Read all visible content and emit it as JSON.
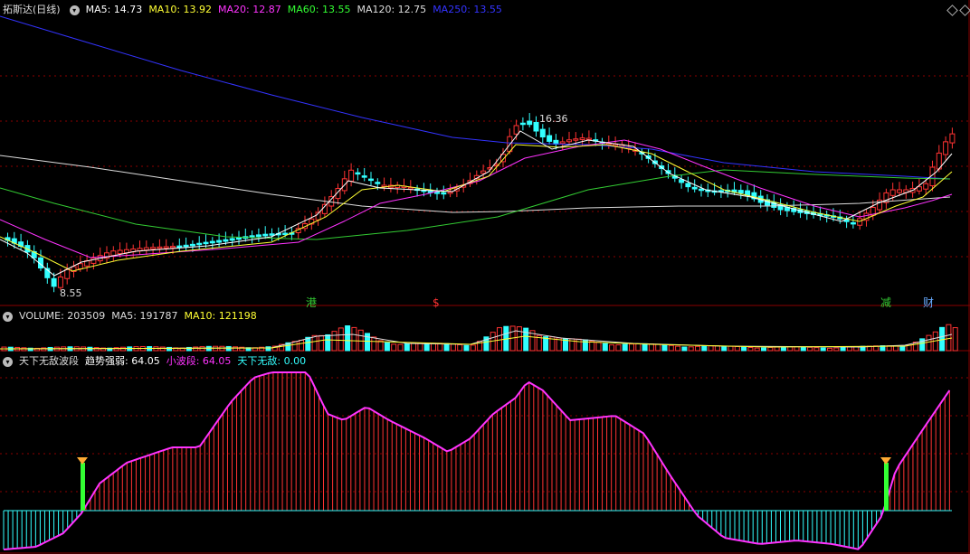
{
  "price_panel": {
    "title": "拓斯达(日线)",
    "indicators": [
      {
        "label": "MA5: 14.73",
        "color": "#ffffff"
      },
      {
        "label": "MA10: 13.92",
        "color": "#ffff33"
      },
      {
        "label": "MA20: 12.87",
        "color": "#ff33ff"
      },
      {
        "label": "MA60: 13.55",
        "color": "#33ff33"
      },
      {
        "label": "MA120: 12.75",
        "color": "#dddddd"
      },
      {
        "label": "MA250: 13.55",
        "color": "#3333ff"
      }
    ],
    "high_label": "16.36",
    "low_label": "8.55",
    "markers": [
      {
        "text": "港",
        "color": "#33cc33"
      },
      {
        "text": "$",
        "color": "#ff3333"
      },
      {
        "text": "减",
        "color": "#33cc33"
      },
      {
        "text": "财",
        "color": "#66aaff"
      }
    ]
  },
  "volume_panel": {
    "indicators": [
      {
        "label": "VOLUME: 203509",
        "color": "#dddddd"
      },
      {
        "label": "MA5: 191787",
        "color": "#dddddd"
      },
      {
        "label": "MA10: 121198",
        "color": "#ffff33"
      }
    ]
  },
  "osc_panel": {
    "title": "天下无敌波段",
    "indicators": [
      {
        "label": "趋势强弱: 64.05",
        "color": "#ffffff"
      },
      {
        "label": "小波段: 64.05",
        "color": "#ff33ff"
      },
      {
        "label": "天下无敌: 0.00",
        "color": "#33ffff"
      }
    ]
  },
  "colors": {
    "up": "#ff3333",
    "down": "#33ffff",
    "grid": "#8b0000",
    "ma5": "#ffffff",
    "ma10": "#ffff33",
    "ma20": "#ff33ff",
    "ma60": "#33cc33",
    "ma120": "#dddddd",
    "ma250": "#3333ff"
  }
}
